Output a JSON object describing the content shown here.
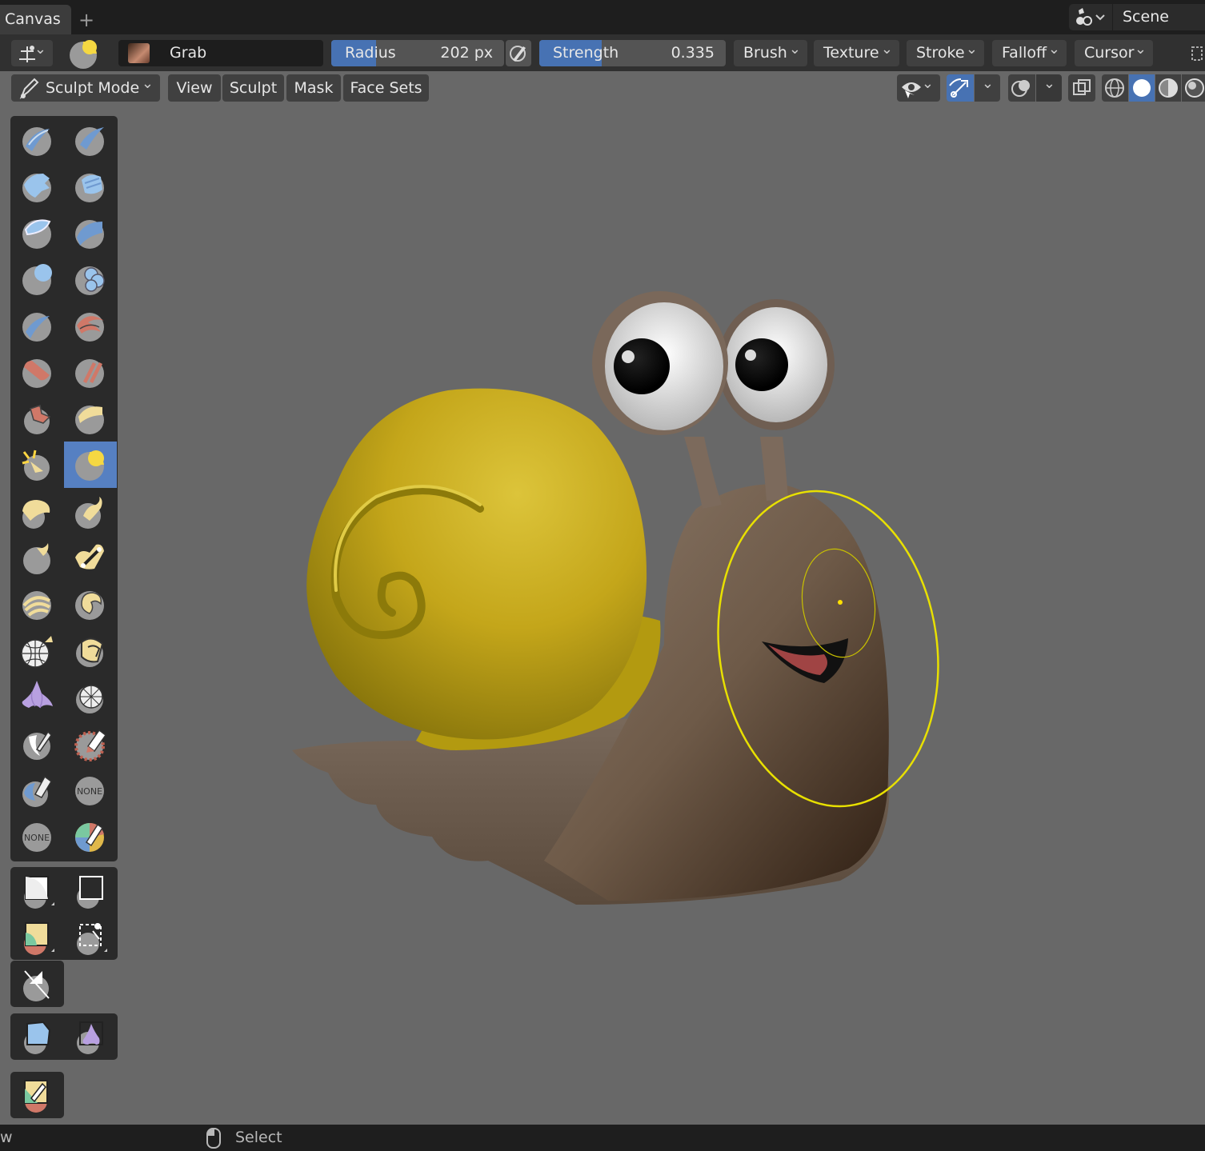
{
  "tabs": {
    "active": "Canvas",
    "add": "+"
  },
  "scene": {
    "name": "Scene",
    "icon": "scene-icon"
  },
  "tool_header": {
    "brush_name": "Grab",
    "radius_label": "Radius",
    "radius_value": "202 px",
    "radius_fill": 0.26,
    "strength_label": "Strength",
    "strength_value": "0.335",
    "strength_fill": 0.335,
    "menus": [
      "Brush",
      "Texture",
      "Stroke",
      "Falloff",
      "Cursor"
    ]
  },
  "viewport_header": {
    "mode": "Sculpt Mode",
    "menus": [
      "View",
      "Sculpt",
      "Mask",
      "Face Sets"
    ]
  },
  "toolbar": {
    "none_label": "NONE",
    "active_tool": "grab"
  },
  "status": {
    "left": "w",
    "select": "Select"
  },
  "colors": {
    "accent": "#4772b3",
    "active_tool": "#5680c2",
    "viewport": "#686868",
    "brush_cursor": "#e8e000",
    "shell": "#c4a61a",
    "body": "#7a6656"
  }
}
